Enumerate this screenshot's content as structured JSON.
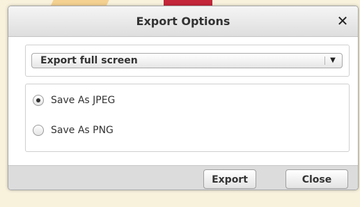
{
  "dialog": {
    "title": "Export Options",
    "close_icon": "close-icon",
    "select": {
      "value": "Export full screen",
      "arrow_icon": "triangle-down-icon"
    },
    "radios": [
      {
        "label": "Save As JPEG",
        "selected": true
      },
      {
        "label": "Save As PNG",
        "selected": false
      }
    ],
    "buttons": {
      "export": "Export",
      "close": "Close"
    }
  },
  "colors": {
    "dialog_bg": "#ffffff",
    "footer_bg": "#dcdcdc",
    "page_bg": "#f8f2dd"
  }
}
